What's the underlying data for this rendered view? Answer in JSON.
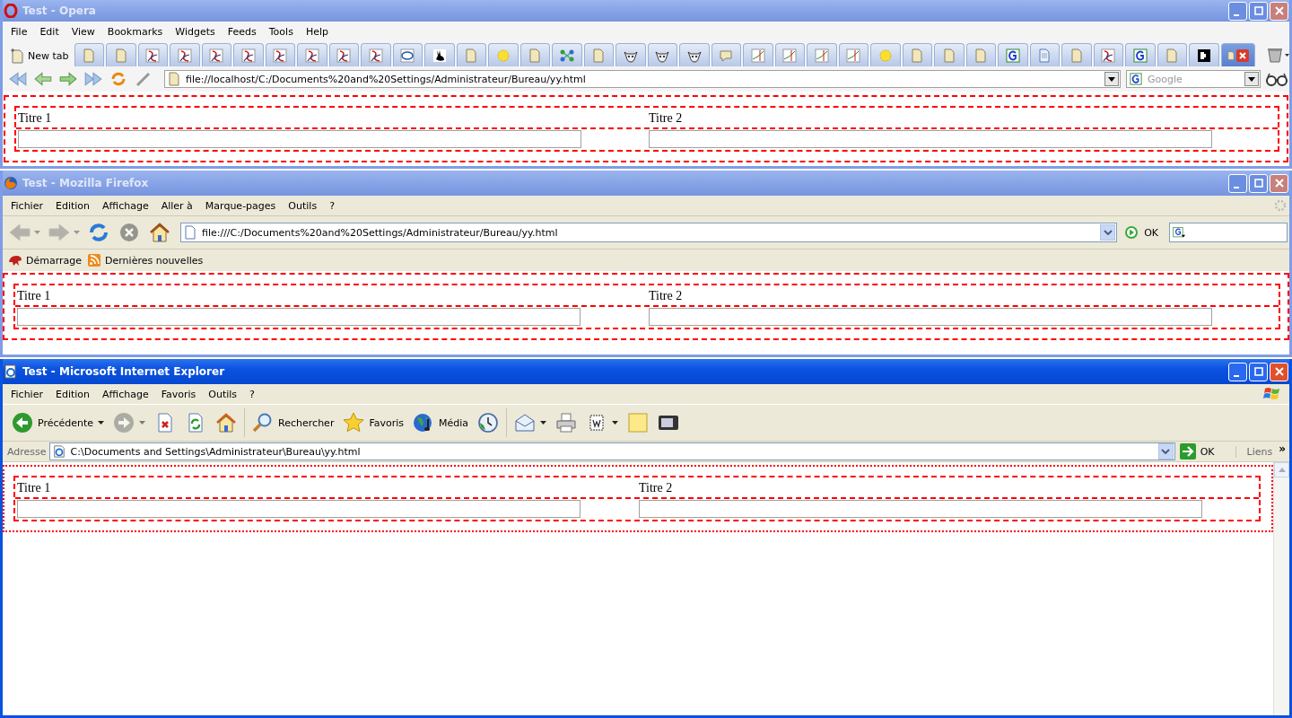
{
  "windows": [
    {
      "kind": "opera",
      "title": "Test - Opera",
      "active": false,
      "menu": [
        "File",
        "Edit",
        "View",
        "Bookmarks",
        "Widgets",
        "Feeds",
        "Tools",
        "Help"
      ],
      "new_tab": "New tab",
      "tabs": [
        {
          "kind": "page",
          "selected": false
        },
        {
          "kind": "page",
          "selected": false
        },
        {
          "kind": "acrobat",
          "selected": false
        },
        {
          "kind": "acrobat",
          "selected": false
        },
        {
          "kind": "acrobat",
          "selected": false
        },
        {
          "kind": "acrobat",
          "selected": false
        },
        {
          "kind": "acrobat",
          "selected": false
        },
        {
          "kind": "acrobat",
          "selected": false
        },
        {
          "kind": "acrobat",
          "selected": false
        },
        {
          "kind": "acrobat",
          "selected": false
        },
        {
          "kind": "intel",
          "selected": false
        },
        {
          "kind": "rabbit",
          "selected": false
        },
        {
          "kind": "page",
          "selected": false
        },
        {
          "kind": "flower",
          "selected": false
        },
        {
          "kind": "page",
          "selected": false
        },
        {
          "kind": "network",
          "selected": false
        },
        {
          "kind": "page",
          "selected": false
        },
        {
          "kind": "cow",
          "selected": false
        },
        {
          "kind": "cow",
          "selected": false
        },
        {
          "kind": "cow",
          "selected": false
        },
        {
          "kind": "note",
          "selected": false
        },
        {
          "kind": "chart",
          "selected": false
        },
        {
          "kind": "chart",
          "selected": false
        },
        {
          "kind": "chart",
          "selected": false
        },
        {
          "kind": "chart",
          "selected": false
        },
        {
          "kind": "flower",
          "selected": false
        },
        {
          "kind": "page",
          "selected": false
        },
        {
          "kind": "page",
          "selected": false
        },
        {
          "kind": "page",
          "selected": false
        },
        {
          "kind": "google",
          "selected": false
        },
        {
          "kind": "doc",
          "selected": false
        },
        {
          "kind": "page",
          "selected": false
        },
        {
          "kind": "acrobat",
          "selected": false
        },
        {
          "kind": "google",
          "selected": false
        },
        {
          "kind": "page",
          "selected": false
        },
        {
          "kind": "puzzle",
          "selected": false
        },
        {
          "kind": "page",
          "selected": true
        }
      ],
      "address": "file://localhost/C:/Documents%20and%20Settings/Administrateur/Bureau/yy.html",
      "search": {
        "placeholder": "Google"
      },
      "page": {
        "columns": [
          {
            "heading": "Titre 1"
          },
          {
            "heading": "Titre 2"
          }
        ]
      }
    },
    {
      "kind": "firefox",
      "title": "Test - Mozilla Firefox",
      "active": false,
      "menu": [
        "Fichier",
        "Edition",
        "Affichage",
        "Aller à",
        "Marque-pages",
        "Outils",
        "?"
      ],
      "nav": [
        {
          "kind": "back",
          "dropdown": true,
          "disabled": true
        },
        {
          "kind": "forward",
          "dropdown": true,
          "disabled": true
        },
        {
          "kind": "reload",
          "dropdown": false,
          "disabled": false
        },
        {
          "kind": "stop",
          "dropdown": false,
          "disabled": true
        },
        {
          "kind": "home",
          "dropdown": false,
          "disabled": false
        }
      ],
      "address": "file:///C:/Documents%20and%20Settings/Administrateur/Bureau/yy.html",
      "go": "OK",
      "bookmarks": [
        {
          "kind": "dino",
          "label": "Démarrage"
        },
        {
          "kind": "feed",
          "label": "Dernières nouvelles"
        }
      ],
      "page": {
        "columns": [
          {
            "heading": "Titre 1"
          },
          {
            "heading": "Titre 2"
          }
        ]
      }
    },
    {
      "kind": "ie",
      "title": "Test - Microsoft Internet Explorer",
      "active": true,
      "menu": [
        "Fichier",
        "Edition",
        "Affichage",
        "Favoris",
        "Outils",
        "?"
      ],
      "groups": [
        {
          "items": [
            {
              "kind": "back",
              "label": "Précédente",
              "dropdown": true,
              "disabled": false
            },
            {
              "kind": "forward",
              "dropdown": true,
              "disabled": true
            },
            {
              "kind": "stop",
              "dropdown": false,
              "disabled": false
            },
            {
              "kind": "reload",
              "dropdown": false,
              "disabled": false
            },
            {
              "kind": "home",
              "dropdown": false,
              "disabled": false
            }
          ]
        },
        {
          "items": [
            {
              "kind": "search",
              "label": "Rechercher",
              "dropdown": false,
              "disabled": false
            },
            {
              "kind": "favorites",
              "label": "Favoris",
              "dropdown": false,
              "disabled": false
            },
            {
              "kind": "media",
              "label": "Média",
              "dropdown": false,
              "disabled": false
            },
            {
              "kind": "history",
              "dropdown": false,
              "disabled": false
            }
          ]
        },
        {
          "items": [
            {
              "kind": "mail",
              "dropdown": true,
              "disabled": false
            },
            {
              "kind": "print",
              "dropdown": false,
              "disabled": false
            },
            {
              "kind": "edit",
              "dropdown": true,
              "disabled": false
            },
            {
              "kind": "note",
              "dropdown": false,
              "disabled": false
            },
            {
              "kind": "messenger",
              "dropdown": false,
              "disabled": false
            }
          ]
        }
      ],
      "address_label": "Adresse",
      "address": "C:\\Documents and Settings\\Administrateur\\Bureau\\yy.html",
      "go": "OK",
      "links": "Liens",
      "more": "»",
      "page": {
        "columns": [
          {
            "heading": "Titre 1"
          },
          {
            "heading": "Titre 2"
          }
        ]
      }
    }
  ]
}
